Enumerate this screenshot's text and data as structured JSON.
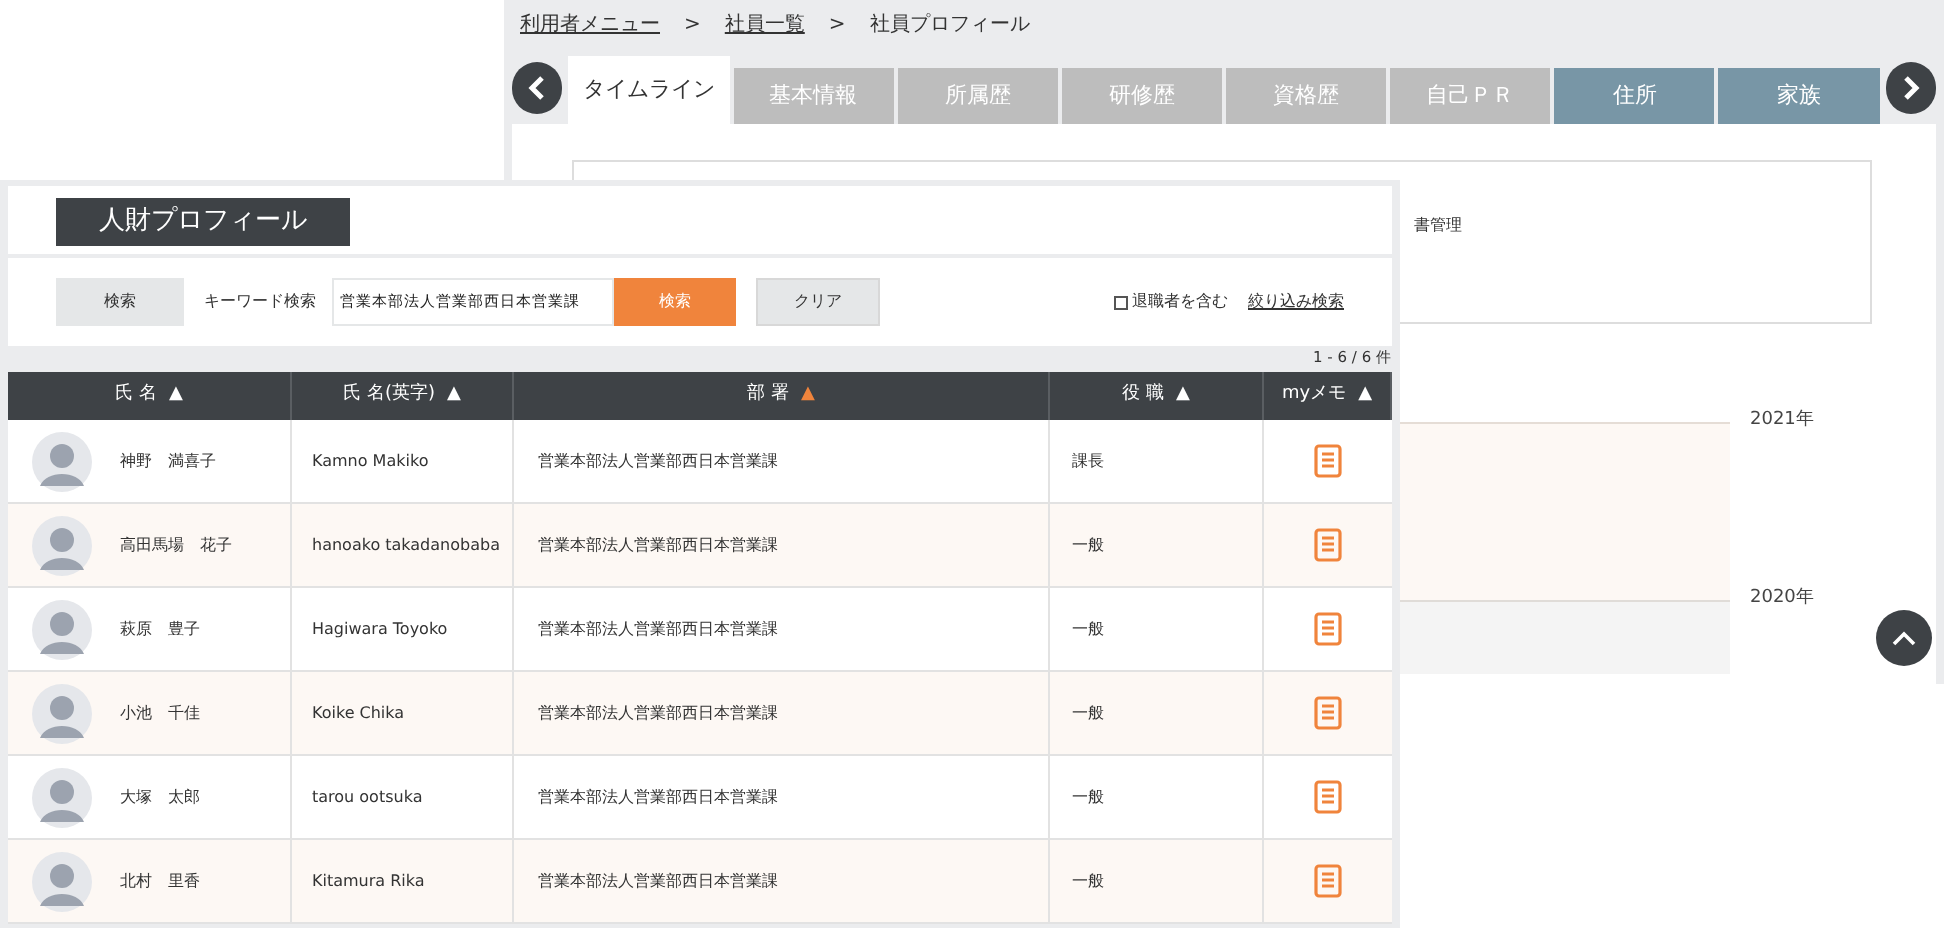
{
  "profile_window": {
    "breadcrumb": [
      {
        "label": "利用者メニュー",
        "link": true
      },
      {
        "label": ">",
        "link": false
      },
      {
        "label": "社員一覧",
        "link": true
      },
      {
        "label": ">",
        "link": false
      },
      {
        "label": "社員プロフィール",
        "link": false
      }
    ],
    "tabs": [
      {
        "label": "タイムライン",
        "selected": true,
        "kind": "basic"
      },
      {
        "label": "基本情報",
        "selected": false,
        "kind": "basic"
      },
      {
        "label": "所属歴",
        "selected": false,
        "kind": "basic"
      },
      {
        "label": "研修歴",
        "selected": false,
        "kind": "basic"
      },
      {
        "label": "資格歴",
        "selected": false,
        "kind": "basic"
      },
      {
        "label": "自己ＰＲ",
        "selected": false,
        "kind": "basic"
      },
      {
        "label": "住所",
        "selected": false,
        "kind": "personal"
      },
      {
        "label": "家族",
        "selected": false,
        "kind": "personal"
      }
    ],
    "filter_text": "書管理",
    "timeline_years": [
      "2021年",
      "2020年"
    ]
  },
  "list_window": {
    "title": "人財プロフィール",
    "search": {
      "tab_label": "検索",
      "keyword_label": "キーワード検索",
      "keyword_value": "営業本部法人営業部西日本営業課",
      "search_button": "検索",
      "clear_button": "クリア",
      "include_retired": {
        "label": "退職者を含む",
        "checked": false
      },
      "filter_link": "絞り込み検索"
    },
    "count": "1 - 6 / 6 件",
    "table": {
      "columns": [
        {
          "label": "氏 名",
          "arrow": "▲",
          "sorted": false
        },
        {
          "label": "氏 名(英字)",
          "arrow": "▲",
          "sorted": false
        },
        {
          "label": "部 署",
          "arrow": "▲",
          "sorted": true
        },
        {
          "label": "役 職",
          "arrow": "▲",
          "sorted": false
        },
        {
          "label": "myメモ",
          "arrow": "▲",
          "sorted": false
        }
      ],
      "rows": [
        {
          "name": "神野　満喜子",
          "name_en": "Kamno Makiko",
          "department": "営業本部法人営業部西日本営業課",
          "position": "課長"
        },
        {
          "name": "高田馬場　花子",
          "name_en": "hanoako takadanobaba",
          "department": "営業本部法人営業部西日本営業課",
          "position": "一般"
        },
        {
          "name": "萩原　豊子",
          "name_en": "Hagiwara Toyoko",
          "department": "営業本部法人営業部西日本営業課",
          "position": "一般"
        },
        {
          "name": "小池　千佳",
          "name_en": "Koike Chika",
          "department": "営業本部法人営業部西日本営業課",
          "position": "一般"
        },
        {
          "name": "大塚　太郎",
          "name_en": "tarou ootsuka",
          "department": "営業本部法人営業部西日本営業課",
          "position": "一般"
        },
        {
          "name": "北村　里香",
          "name_en": "Kitamura Rika",
          "department": "営業本部法人営業部西日本営業課",
          "position": "一般"
        }
      ]
    }
  }
}
